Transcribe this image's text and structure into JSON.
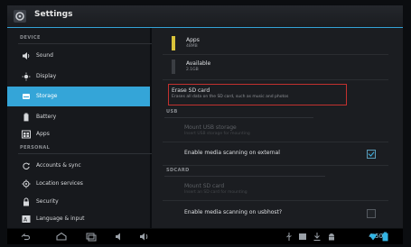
{
  "title": "Settings",
  "left_pane": {
    "sections": [
      {
        "header": "DEVICE",
        "items": [
          {
            "label": "Sound",
            "icon": "speaker-icon"
          },
          {
            "label": "Display",
            "icon": "display-icon"
          },
          {
            "label": "Storage",
            "icon": "storage-icon",
            "selected": true
          },
          {
            "label": "Battery",
            "icon": "battery-icon"
          },
          {
            "label": "Apps",
            "icon": "apps-icon"
          }
        ]
      },
      {
        "header": "PERSONAL",
        "items": [
          {
            "label": "Accounts & sync",
            "icon": "sync-icon"
          },
          {
            "label": "Location services",
            "icon": "location-icon"
          },
          {
            "label": "Security",
            "icon": "lock-icon"
          },
          {
            "label": "Language & input",
            "icon": "language-icon"
          }
        ]
      }
    ]
  },
  "storage": {
    "apps": {
      "title": "Apps",
      "value": "48MB"
    },
    "available": {
      "title": "Available",
      "value": "2.1GB"
    },
    "erase": {
      "title": "Erase SD card",
      "summary": "Erases all data on the SD card, such as music and photos"
    },
    "usb_header": "USB",
    "usb_rows": [
      {
        "title": "Mount USB storage",
        "summary": "Insert USB storage for mounting"
      },
      {
        "title": "Enable media scanning on external",
        "checked": true
      }
    ],
    "sdcard_header": "SDCARD",
    "sdcard_rows": [
      {
        "title": "Mount SD card",
        "summary": "Insert an SD card for mounting"
      },
      {
        "title": "Enable media scanning on usbhost?",
        "checked": false
      }
    ]
  },
  "status_bar": {
    "time": "4:50",
    "icons": [
      "usb-icon",
      "gallery-icon",
      "download-icon",
      "android-icon",
      "wifi-icon",
      "battery-icon"
    ]
  },
  "colors": {
    "accent": "#34a5d8",
    "highlight_box": "#c2312f"
  }
}
